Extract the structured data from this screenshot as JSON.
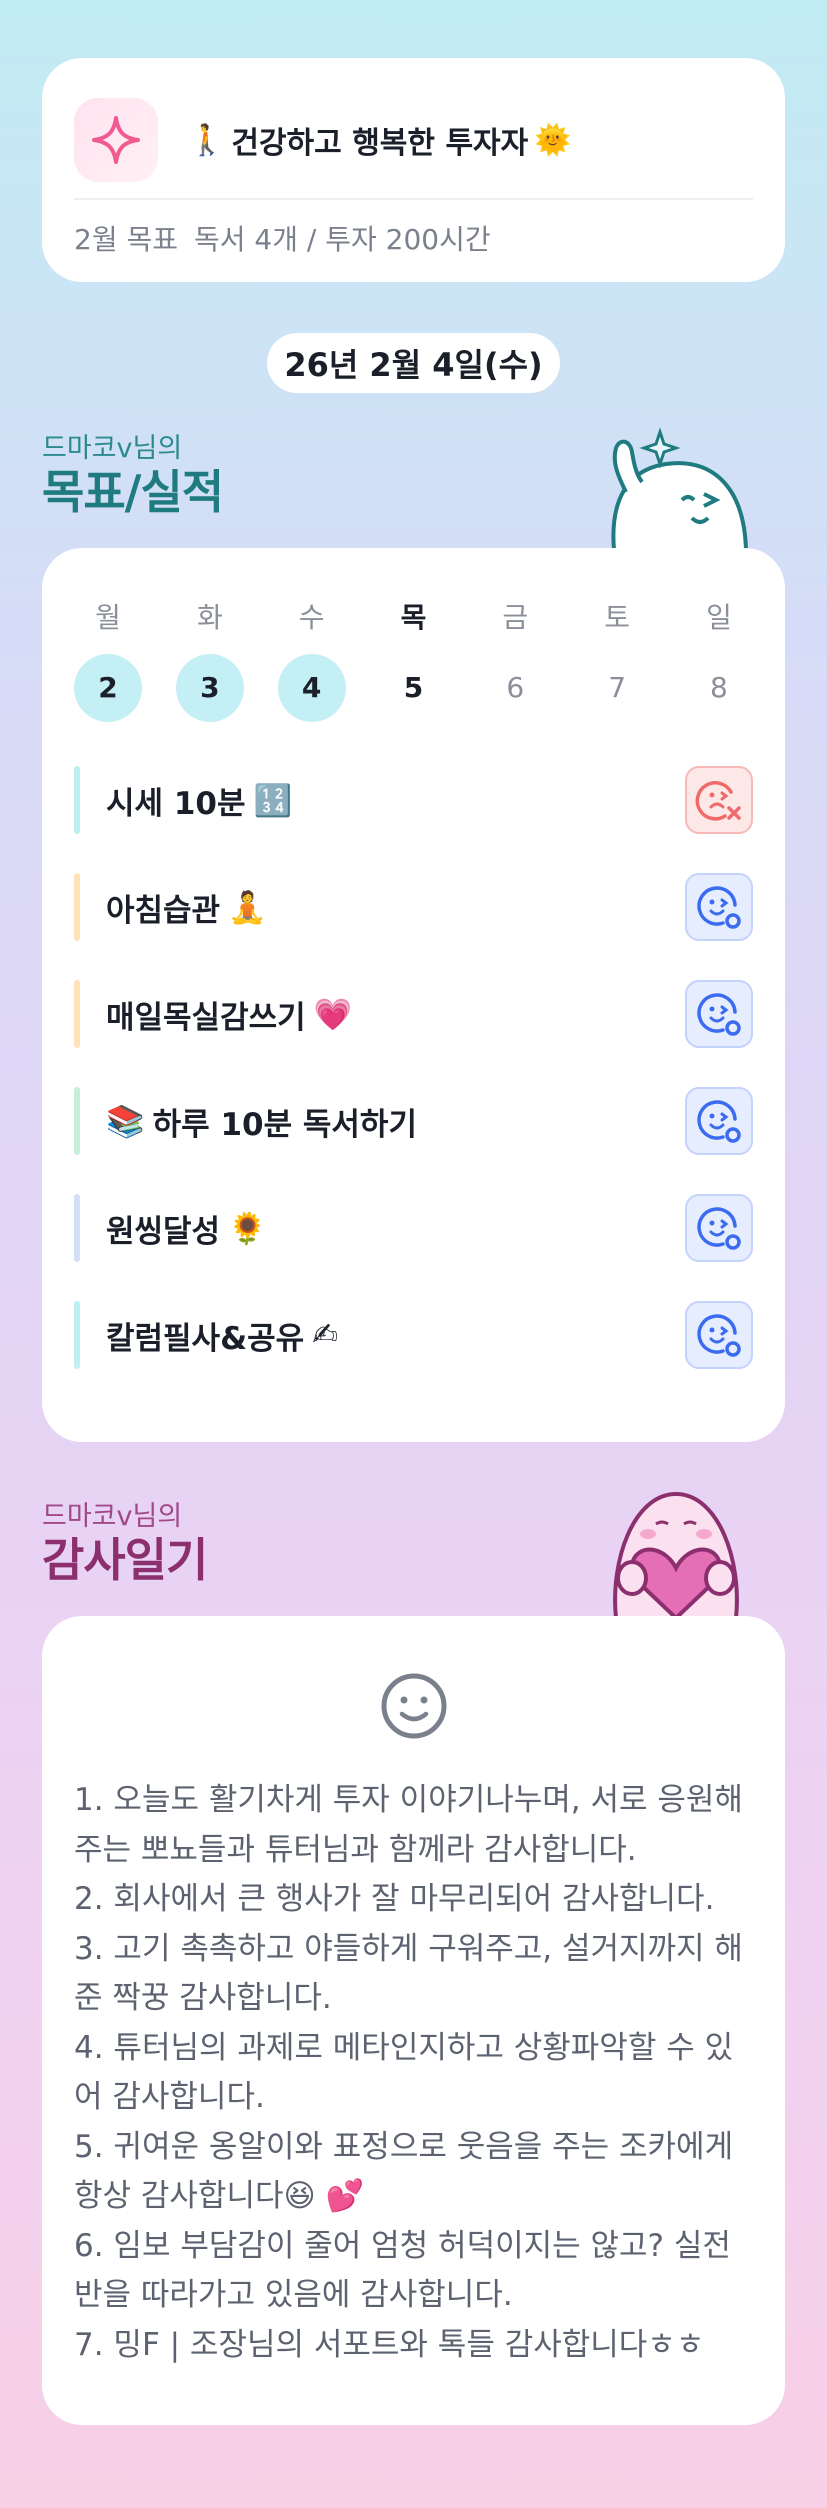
{
  "profile": {
    "title": "건강하고 행복한 투자자",
    "title_emoji_left": "🚶",
    "title_emoji_right": "🌞",
    "goal_label": "2월 목표",
    "goal_text": "독서 4개 / 투자 200시간"
  },
  "date": "26년 2월 4일(수)",
  "goals_section": {
    "subtitle": "드마코v님의",
    "title": "목표/실적"
  },
  "week": {
    "days": [
      "월",
      "화",
      "수",
      "목",
      "금",
      "토",
      "일"
    ],
    "dates": [
      "2",
      "3",
      "4",
      "5",
      "6",
      "7",
      "8"
    ]
  },
  "habits": [
    {
      "label": "시세 10분",
      "emoji": "🔢",
      "status": "fail"
    },
    {
      "label": "아침습관",
      "emoji": "🧘",
      "status": "ok"
    },
    {
      "label": "매일목실감쓰기",
      "emoji": "💗",
      "status": "ok"
    },
    {
      "label": "하루 10분 독서하기",
      "emoji": "📚",
      "status": "ok"
    },
    {
      "label": "원씽달성",
      "emoji": "🌻",
      "status": "ok"
    },
    {
      "label": "칼럼필사&공유",
      "emoji": "✍",
      "status": "ok"
    }
  ],
  "gratitude_section": {
    "subtitle": "드마코v님의",
    "title": "감사일기"
  },
  "gratitude": [
    "1. 오늘도 활기차게 투자 이야기나누며, 서로 응원해주는 뽀뇨들과 튜터님과 함께라 감사합니다.",
    "2. 회사에서 큰 행사가 잘 마무리되어 감사합니다.",
    "3. 고기 촉촉하고 야들하게 구워주고, 설거지까지 해준 짝꿍 감사합니다.",
    "4. 튜터님의 과제로 메타인지하고 상황파악할 수 있어 감사합니다.",
    "5. 귀여운 옹알이와 표정으로 웃음을 주는 조카에게 항상 감사합니다😆 💕",
    "6. 임보 부담감이 줄어 엄청 허덕이지는 않고? 실전반을 따라가고 있음에 감사합니다.",
    "7. 밍F | 조장님의 서포트와 톡들 감사합니다ㅎㅎ"
  ],
  "colors": {
    "teal_title": "#1f7b80",
    "pink_title": "#8b2f6f",
    "done_day": "#c4eff5",
    "ok_icon": "#3b6cf0",
    "fail_icon": "#f06a6a"
  }
}
